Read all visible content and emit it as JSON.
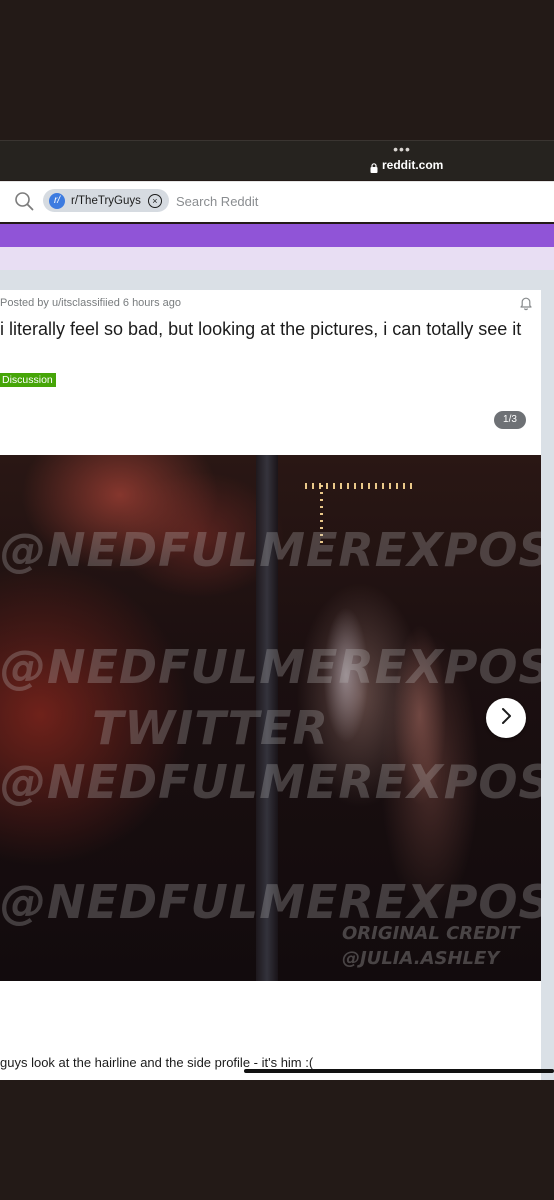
{
  "browser": {
    "menu_dots": "•••",
    "url": "reddit.com"
  },
  "search": {
    "subreddit_avatar_glyph": "r/",
    "subreddit": "r/TheTryGuys",
    "placeholder": "Search Reddit"
  },
  "post": {
    "meta": "Posted by u/itsclassifiied 6 hours ago",
    "title": "i literally feel so bad, but looking at the pictures, i can totally see it",
    "flair": "Discussion",
    "gallery_counter": "1/3",
    "body": "guys look at the hairline and the side profile - it's him :(",
    "image": {
      "watermarks": [
        "@NEDFULMEREXPOSE",
        "@NEDFULMEREXPOSE",
        "TWITTER",
        "@NEDFULMEREXPOSE",
        "@NEDFULMEREXPOSE"
      ],
      "credit_line_1": "ORIGINAL CREDIT",
      "credit_line_2": "@JULIA.ASHLEY"
    }
  },
  "colors": {
    "banner": "#9054d7",
    "flair": "#46a508",
    "chip_avatar": "#3d7be0"
  },
  "icons": [
    "lock-icon",
    "search-icon",
    "close-icon",
    "bell-icon",
    "chevron-right-icon"
  ]
}
